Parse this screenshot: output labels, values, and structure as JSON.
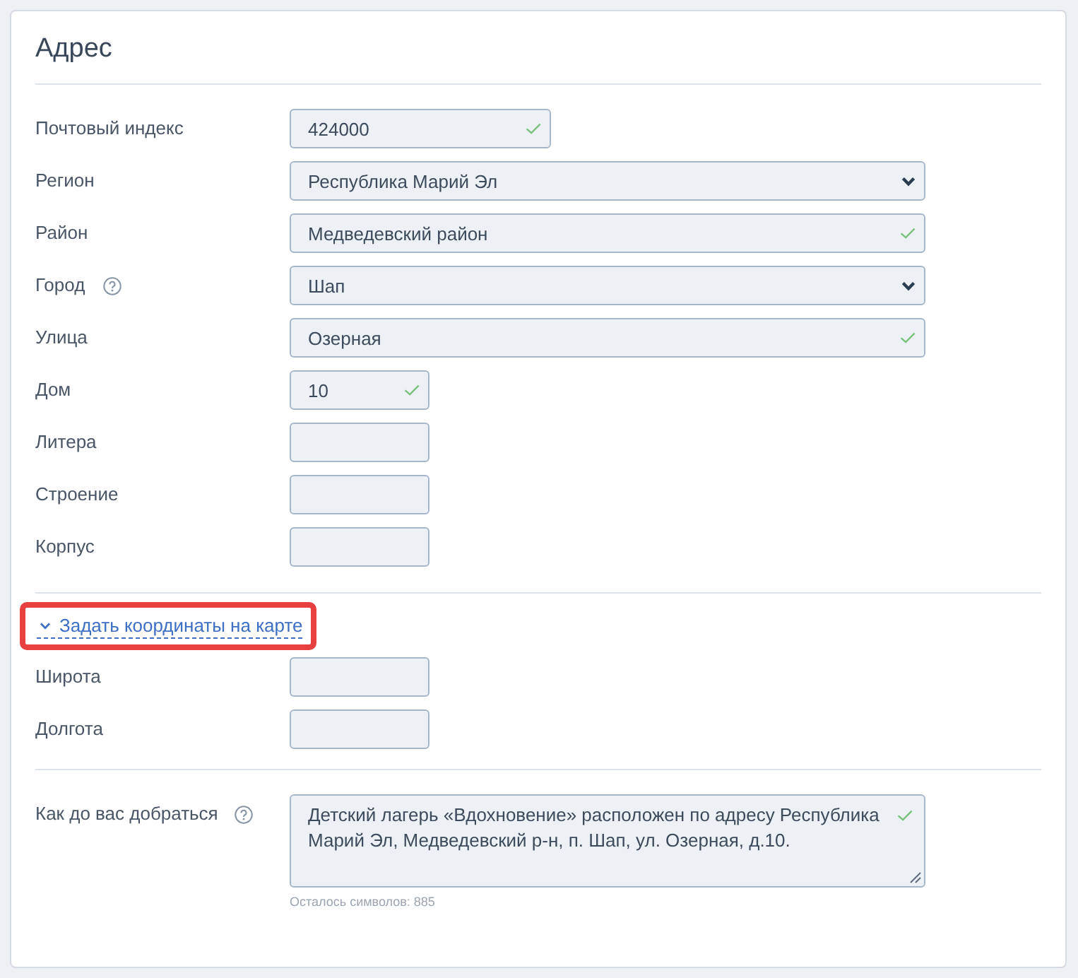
{
  "card": {
    "title": "Адрес"
  },
  "fields": [
    {
      "kind": "index",
      "label": "Почтовый индекс",
      "value": "424000",
      "valid": true
    },
    {
      "kind": "select",
      "label": "Регион",
      "value": "Республика Марий Эл"
    },
    {
      "kind": "text",
      "label": "Район",
      "value": "Медведевский район",
      "valid": true
    },
    {
      "kind": "select",
      "label": "Город",
      "help": true,
      "value": "Шап"
    },
    {
      "kind": "text",
      "label": "Улица",
      "value": "Озерная",
      "valid": true
    },
    {
      "kind": "short",
      "label": "Дом",
      "value": "10",
      "valid": true
    },
    {
      "kind": "short",
      "label": "Литера",
      "valid": false
    },
    {
      "kind": "short",
      "label": "Строение",
      "valid": false
    },
    {
      "kind": "short",
      "label": "Корпус",
      "valid": false
    }
  ],
  "map_link": {
    "label": "Задать координаты на карте",
    "expanded": true,
    "highlighted": true
  },
  "coordinates": [
    {
      "kind": "short",
      "label": "Широта",
      "valid": false
    },
    {
      "kind": "short",
      "label": "Долгота",
      "valid": false
    }
  ],
  "directions": {
    "label": "Как до вас добраться",
    "help": true,
    "value": "Детский лагерь «Вдохновение» расположен по адресу Республика Марий Эл, Медведевский р-н, п. Шап, ул. Озерная, д.10.",
    "valid": true,
    "counter": "Осталось символов: 885"
  }
}
